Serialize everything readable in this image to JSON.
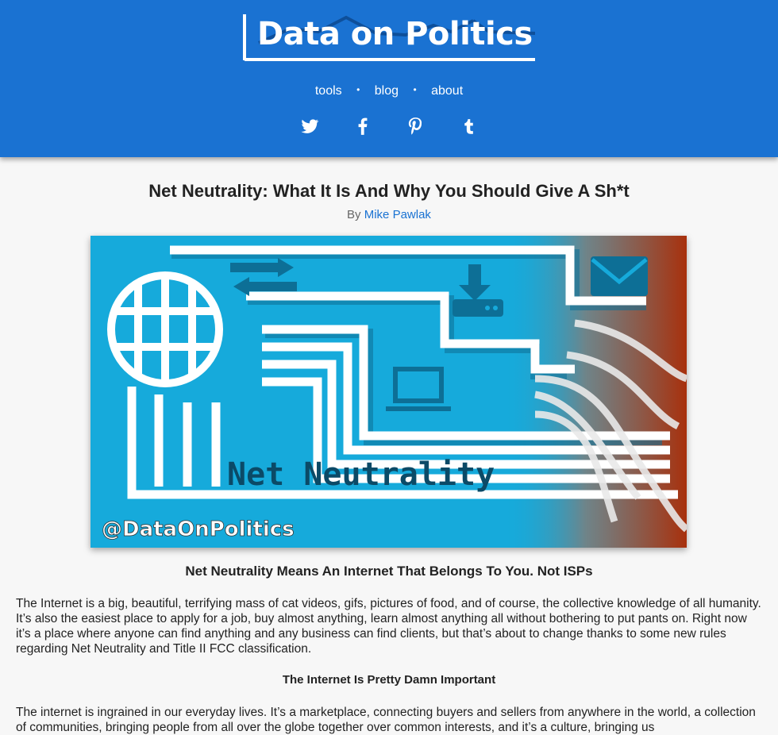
{
  "site": {
    "logo": "Data on Politics",
    "nav": {
      "tools": "tools",
      "blog": "blog",
      "about": "about",
      "separator": "•"
    },
    "social": [
      "twitter-icon",
      "facebook-icon",
      "pinterest-icon",
      "tumblr-icon"
    ],
    "colors": {
      "brand": "#1a72d2",
      "background": "#f7f7f7",
      "hero_blue": "#16aadb"
    }
  },
  "article": {
    "title": "Net Neutrality: What It Is And Why You Should Give A Sh*t",
    "byline_prefix": "By",
    "author": "Mike Pawlak",
    "hero": {
      "caption": "Net Neutrality",
      "handle": "@DataOnPolitics"
    },
    "heading1": "Net Neutrality Means An Internet That Belongs To You. Not ISPs",
    "paragraph1": "The Internet is a big, beautiful, terrifying mass of cat videos, gifs, pictures of food, and of course, the collective knowledge of all humanity. It’s also the easiest place to apply for a job, buy almost anything, learn almost anything all without bothering to put pants on. Right now it’s a place where anyone can find anything and any business can find clients, but that’s about to change thanks to some new rules regarding Net Neutrality and Title II FCC classification.",
    "heading2": "The Internet Is Pretty Damn Important",
    "paragraph2": "The internet is ingrained in our everyday lives. It’s a marketplace, connecting buyers and sellers from anywhere in the world, a collection of communities, bringing people from all over the globe together over common interests, and it’s a culture, bringing us"
  }
}
